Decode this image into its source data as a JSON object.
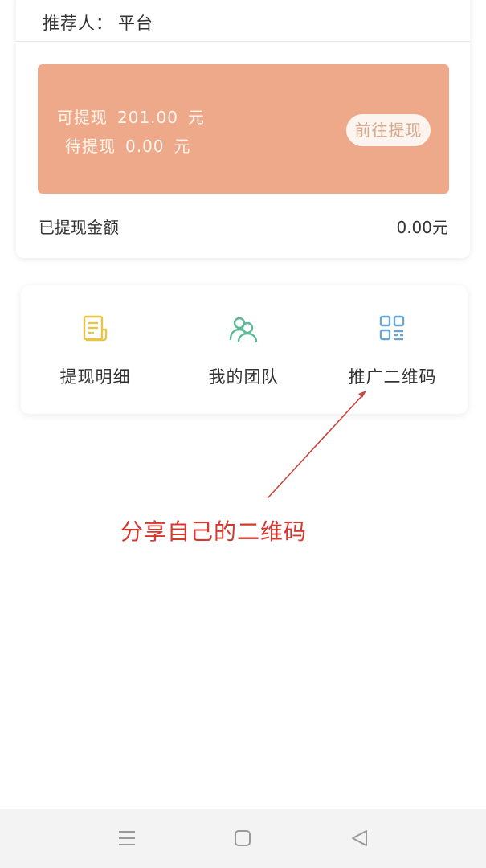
{
  "referrer": {
    "label": "推荐人",
    "separator": "：",
    "value": "平台"
  },
  "balance": {
    "available_label": "可提现",
    "available_amount": "201.00",
    "pending_label": "待提现",
    "pending_amount": "0.00",
    "unit": "元",
    "withdraw_button": "前往提现",
    "panel_color": "#eea98a"
  },
  "withdrawn": {
    "label": "已提现金额",
    "value": "0.00元"
  },
  "menu": {
    "items": [
      {
        "label": "提现明细",
        "icon": "document-icon",
        "color": "#e8c546"
      },
      {
        "label": "我的团队",
        "icon": "team-icon",
        "color": "#5cb896"
      },
      {
        "label": "推广二维码",
        "icon": "qrcode-icon",
        "color": "#6aa4cf"
      }
    ]
  },
  "annotation": {
    "text": "分享自己的二维码",
    "color": "#d6382e"
  },
  "nav": {
    "items": [
      "menu-icon",
      "home-icon",
      "back-icon"
    ]
  }
}
